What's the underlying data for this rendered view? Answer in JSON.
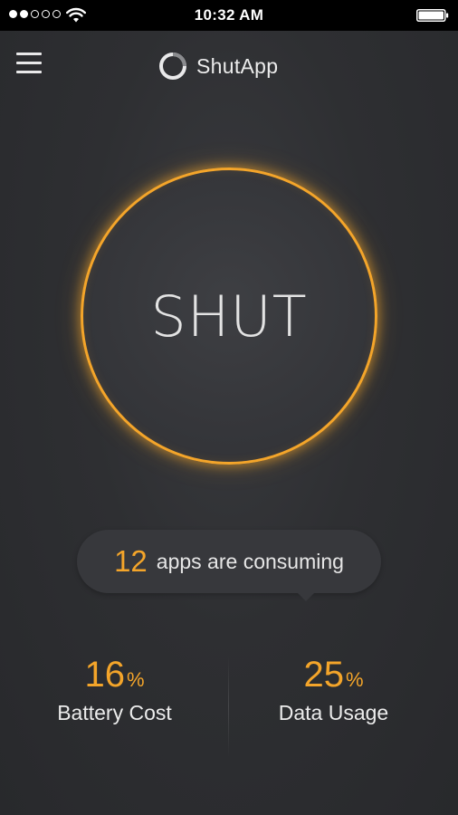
{
  "status_bar": {
    "signal_filled": 2,
    "signal_total": 5,
    "time": "10:32 AM",
    "battery_level": 1.0
  },
  "header": {
    "menu_icon": "hamburger-icon",
    "logo_icon": "ring-logo-icon",
    "app_name": "ShutApp"
  },
  "main_button": {
    "label": "SHUT"
  },
  "consuming": {
    "count": "12",
    "text": "apps are consuming"
  },
  "stats": {
    "battery": {
      "value": "16",
      "unit": "%",
      "label": "Battery Cost"
    },
    "data": {
      "value": "25",
      "unit": "%",
      "label": "Data Usage"
    }
  },
  "colors": {
    "accent": "#f4a52a",
    "background": "#2e2f32",
    "text": "#ececec"
  }
}
